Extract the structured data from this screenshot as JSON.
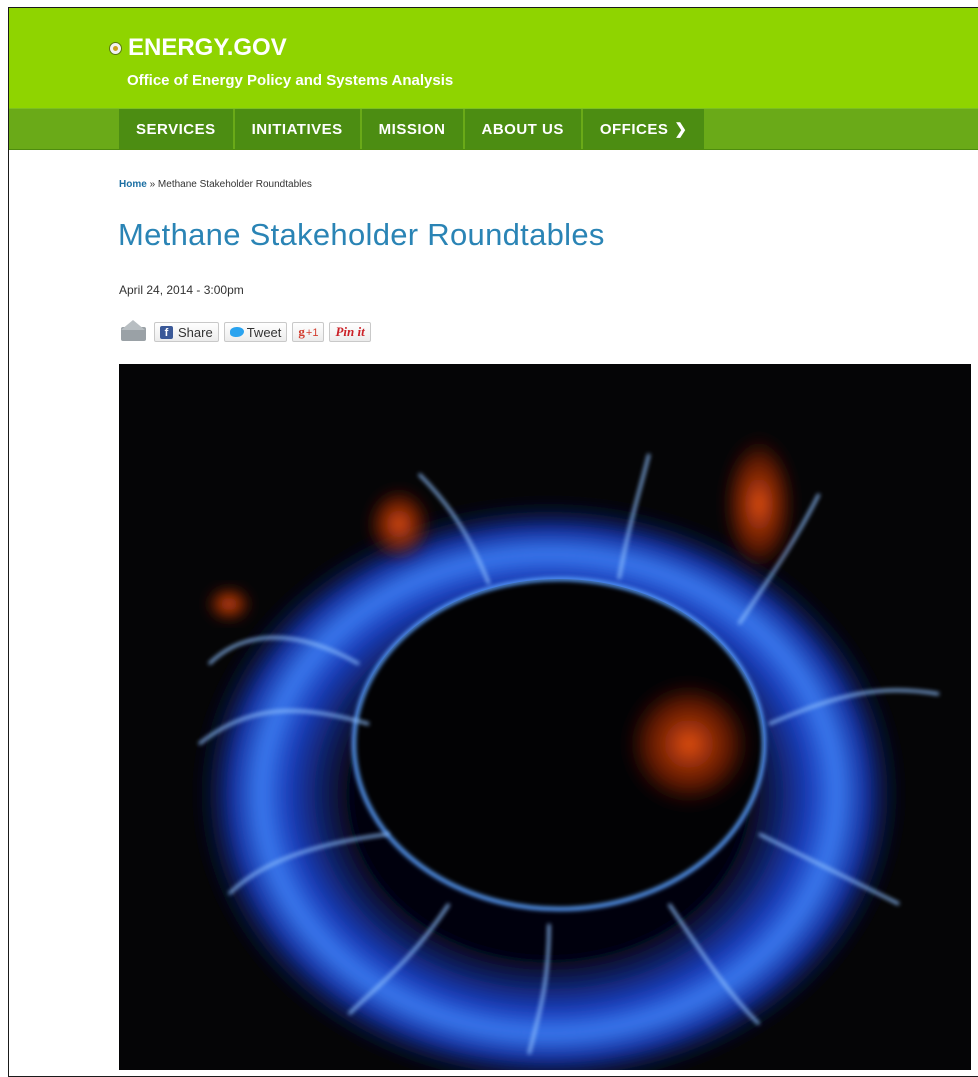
{
  "header": {
    "site_name": "ENERGY.GOV",
    "subtitle": "Office of Energy Policy and Systems Analysis",
    "colors": {
      "header_green": "#8fd400",
      "nav_green": "#6aaa18",
      "nav_item": "#4c8d12"
    }
  },
  "nav": {
    "items": [
      {
        "label": "SERVICES"
      },
      {
        "label": "INITIATIVES"
      },
      {
        "label": "MISSION"
      },
      {
        "label": "ABOUT US"
      },
      {
        "label": "OFFICES",
        "icon": "chevron-right-icon"
      }
    ],
    "offices_chevron": "❯"
  },
  "breadcrumb": {
    "home": "Home",
    "separator": "»",
    "current": "Methane Stakeholder Roundtables"
  },
  "page": {
    "title": "Methane Stakeholder Roundtables",
    "date": "April 24, 2014 - 3:00pm",
    "title_color": "#2a84b5"
  },
  "share": {
    "email_icon": "email-icon",
    "facebook_label": "Share",
    "twitter_label": "Tweet",
    "gplus_label": "g",
    "gplus_count": "+1",
    "pinterest_label": "Pin it"
  },
  "hero": {
    "icon": "gas-burner-flame-image"
  }
}
